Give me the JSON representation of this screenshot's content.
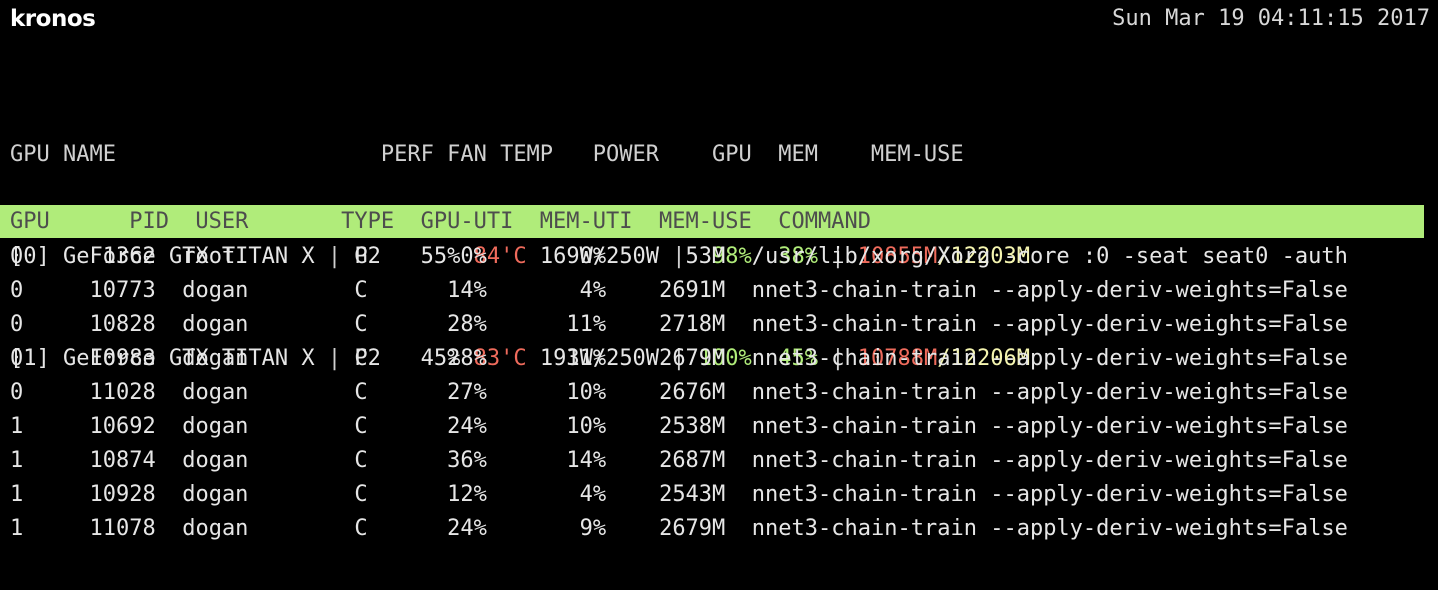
{
  "window": {
    "hostname": "kronos",
    "timestamp": "Sun Mar 19 04:11:15 2017",
    "background_color": "#000000",
    "foreground_color": "#e6e6e6"
  },
  "colors": {
    "green": "#b0ec7a",
    "red": "#ef6b5c",
    "cream": "#f5f5b0",
    "header_gray": "#d0d0d0",
    "proc_header_bg": "#b0ec7a",
    "proc_header_fg": "#4d4d4d"
  },
  "gpu_table": {
    "headers": {
      "gpu": "GPU",
      "name": "NAME",
      "perf": "PERF",
      "fan": "FAN",
      "temp": "TEMP",
      "power": "POWER",
      "gpu_util": "GPU",
      "mem_util": "MEM",
      "mem_use": "MEM-USE"
    },
    "header_line": "GPU NAME                    PERF FAN TEMP   POWER    GPU  MEM    MEM-USE",
    "rows": [
      {
        "index": "[0]",
        "name": "GeForce GTX TITAN X",
        "sep1": "|",
        "perf": "P2",
        "fan": "55%",
        "temp": "84'C",
        "power": "169W/250W",
        "sep2": "|",
        "gpu_util": "98%",
        "mem_util": "38%",
        "sep3": "|",
        "mem_used": "10855M",
        "mem_total": "/12203M"
      },
      {
        "index": "[1]",
        "name": "GeForce GTX TITAN X",
        "sep1": "|",
        "perf": "P2",
        "fan": "45%",
        "temp": "83'C",
        "power": "193W/250W",
        "sep2": "|",
        "gpu_util": "100%",
        "mem_util": "45%",
        "sep3": "|",
        "mem_used": "10788M",
        "mem_total": "/12206M"
      }
    ]
  },
  "process_table": {
    "headers": {
      "gpu": "GPU",
      "pid": "PID",
      "user": "USER",
      "type": "TYPE",
      "gpu_uti": "GPU-UTI",
      "mem_uti": "MEM-UTI",
      "mem_use": "MEM-USE",
      "command": "COMMAND"
    },
    "header_line": "GPU      PID  USER       TYPE  GPU-UTI  MEM-UTI  MEM-USE  COMMAND",
    "rows": [
      {
        "gpu": "0",
        "pid": "1362",
        "user": "root",
        "type": "G",
        "gpu_uti": "0%",
        "mem_uti": "0%",
        "mem_use": "53M",
        "command": "/usr/lib/xorg/Xorg -core :0 -seat seat0 -auth"
      },
      {
        "gpu": "0",
        "pid": "10773",
        "user": "dogan",
        "type": "C",
        "gpu_uti": "14%",
        "mem_uti": "4%",
        "mem_use": "2691M",
        "command": "nnet3-chain-train --apply-deriv-weights=False"
      },
      {
        "gpu": "0",
        "pid": "10828",
        "user": "dogan",
        "type": "C",
        "gpu_uti": "28%",
        "mem_uti": "11%",
        "mem_use": "2718M",
        "command": "nnet3-chain-train --apply-deriv-weights=False"
      },
      {
        "gpu": "0",
        "pid": "10983",
        "user": "dogan",
        "type": "C",
        "gpu_uti": "28%",
        "mem_uti": "11%",
        "mem_use": "2679M",
        "command": "nnet3-chain-train --apply-deriv-weights=False"
      },
      {
        "gpu": "0",
        "pid": "11028",
        "user": "dogan",
        "type": "C",
        "gpu_uti": "27%",
        "mem_uti": "10%",
        "mem_use": "2676M",
        "command": "nnet3-chain-train --apply-deriv-weights=False"
      },
      {
        "gpu": "1",
        "pid": "10692",
        "user": "dogan",
        "type": "C",
        "gpu_uti": "24%",
        "mem_uti": "10%",
        "mem_use": "2538M",
        "command": "nnet3-chain-train --apply-deriv-weights=False"
      },
      {
        "gpu": "1",
        "pid": "10874",
        "user": "dogan",
        "type": "C",
        "gpu_uti": "36%",
        "mem_uti": "14%",
        "mem_use": "2687M",
        "command": "nnet3-chain-train --apply-deriv-weights=False"
      },
      {
        "gpu": "1",
        "pid": "10928",
        "user": "dogan",
        "type": "C",
        "gpu_uti": "12%",
        "mem_uti": "4%",
        "mem_use": "2543M",
        "command": "nnet3-chain-train --apply-deriv-weights=False"
      },
      {
        "gpu": "1",
        "pid": "11078",
        "user": "dogan",
        "type": "C",
        "gpu_uti": "24%",
        "mem_uti": "9%",
        "mem_use": "2679M",
        "command": "nnet3-chain-train --apply-deriv-weights=False"
      }
    ]
  }
}
